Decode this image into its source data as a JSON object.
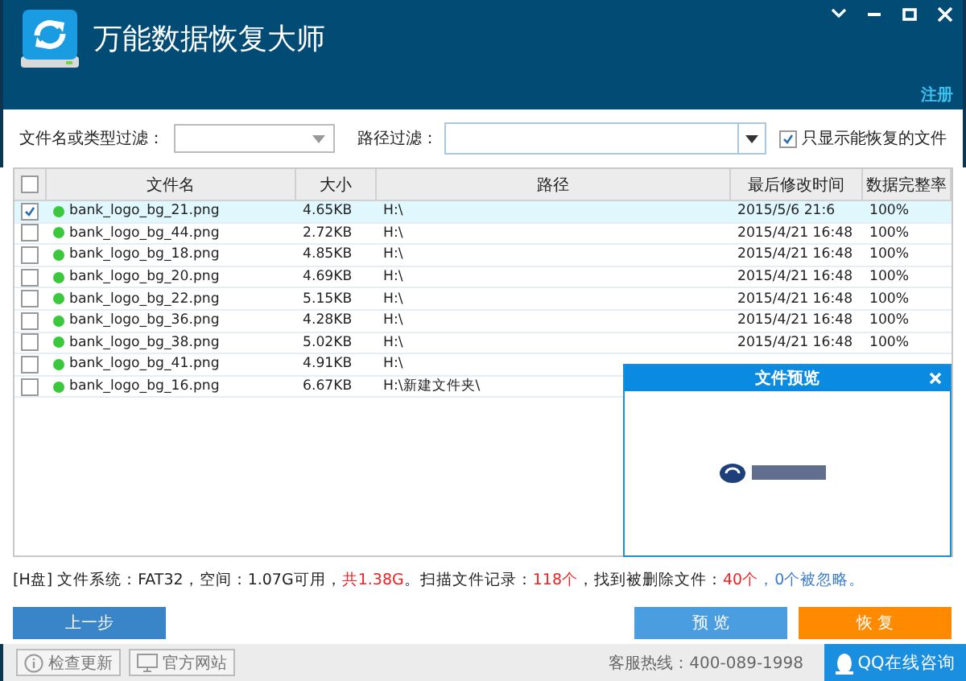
{
  "window": {
    "title": "万能数据恢复大师",
    "register_link": "注册"
  },
  "filters": {
    "name_label": "文件名或类型过滤：",
    "path_label": "路径过滤：",
    "only_recoverable": {
      "label": "只显示能恢复的文件",
      "checked": true
    }
  },
  "table": {
    "columns": [
      "文件名",
      "大小",
      "路径",
      "最后修改时间",
      "数据完整率"
    ],
    "all_checked": false,
    "rows": [
      {
        "checked": true,
        "selected": true,
        "color": "#3cc83c",
        "name": "bank_logo_bg_21.png",
        "size": "4.65KB",
        "path": "H:\\",
        "modified": "2015/5/6 21:6",
        "integrity": "100%"
      },
      {
        "checked": false,
        "selected": false,
        "color": "#3cc83c",
        "name": "bank_logo_bg_44.png",
        "size": "2.72KB",
        "path": "H:\\",
        "modified": "2015/4/21 16:48",
        "integrity": "100%"
      },
      {
        "checked": false,
        "selected": false,
        "color": "#3cc83c",
        "name": "bank_logo_bg_18.png",
        "size": "4.85KB",
        "path": "H:\\",
        "modified": "2015/4/21 16:48",
        "integrity": "100%"
      },
      {
        "checked": false,
        "selected": false,
        "color": "#3cc83c",
        "name": "bank_logo_bg_20.png",
        "size": "4.69KB",
        "path": "H:\\",
        "modified": "2015/4/21 16:48",
        "integrity": "100%"
      },
      {
        "checked": false,
        "selected": false,
        "color": "#3cc83c",
        "name": "bank_logo_bg_22.png",
        "size": "5.15KB",
        "path": "H:\\",
        "modified": "2015/4/21 16:48",
        "integrity": "100%"
      },
      {
        "checked": false,
        "selected": false,
        "color": "#3cc83c",
        "name": "bank_logo_bg_36.png",
        "size": "4.28KB",
        "path": "H:\\",
        "modified": "2015/4/21 16:48",
        "integrity": "100%"
      },
      {
        "checked": false,
        "selected": false,
        "color": "#3cc83c",
        "name": "bank_logo_bg_38.png",
        "size": "5.02KB",
        "path": "H:\\",
        "modified": "2015/4/21 16:48",
        "integrity": "100%"
      },
      {
        "checked": false,
        "selected": false,
        "color": "#3cc83c",
        "name": "bank_logo_bg_41.png",
        "size": "4.91KB",
        "path": "H:\\"
      },
      {
        "checked": false,
        "selected": false,
        "color": "#3cc83c",
        "name": "bank_logo_bg_16.png",
        "size": "6.67KB",
        "path": "H:\\新建文件夹\\"
      }
    ]
  },
  "preview": {
    "title": "文件预览"
  },
  "status": [
    {
      "text": "[H盘] 文件系统：FAT32，空间：1.07G可用，",
      "color": "#222222"
    },
    {
      "text": "共1.38G",
      "color": "#f02020"
    },
    {
      "text": "。扫描文件记录：",
      "color": "#222222"
    },
    {
      "text": "118个",
      "color": "#f02020"
    },
    {
      "text": "，找到被删除文件：",
      "color": "#222222"
    },
    {
      "text": "40个",
      "color": "#f02020"
    },
    {
      "text": "，0个被忽略。",
      "color": "#3a7bd0"
    }
  ],
  "buttons": {
    "back": "上一步",
    "preview": "预 览",
    "recover": "恢 复"
  },
  "footer": {
    "check_update": "检查更新",
    "website": "官方网站",
    "hotline": "客服热线：400-089-1998",
    "qq": "QQ在线咨询"
  }
}
